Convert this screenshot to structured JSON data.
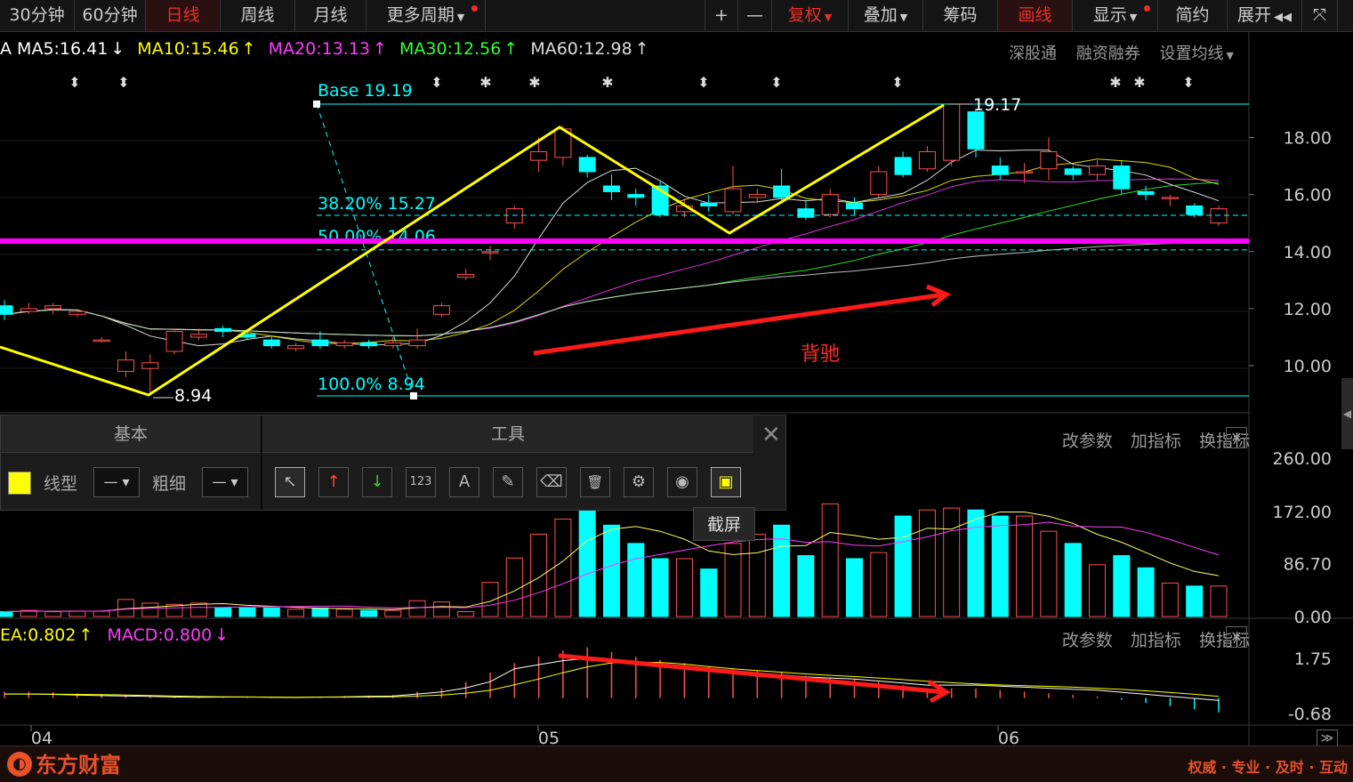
{
  "topbar": {
    "items": [
      {
        "label": "30分钟",
        "active": false
      },
      {
        "label": "60分钟",
        "active": false
      },
      {
        "label": "日线",
        "active": true
      },
      {
        "label": "周线",
        "active": false
      },
      {
        "label": "月线",
        "active": false
      },
      {
        "label": "更多周期",
        "active": false
      },
      {
        "label": "+",
        "active": false
      },
      {
        "label": "—",
        "active": false
      },
      {
        "label": "复权",
        "active": true
      },
      {
        "label": "叠加",
        "active": false
      },
      {
        "label": "筹码",
        "active": false
      },
      {
        "label": "画线",
        "active": true
      },
      {
        "label": "显示",
        "active": false
      },
      {
        "label": "简约",
        "active": false
      },
      {
        "label": "展开",
        "active": false
      }
    ]
  },
  "ma_header": {
    "ma5": "MA5:16.41",
    "ma10": "MA10:15.46",
    "ma20": "MA20:13.13",
    "ma30": "MA30:12.56",
    "ma60": "MA60:12.98",
    "ma5_arrow": "↓",
    "ma10_arrow": "↑",
    "ma20_arrow": "↑",
    "ma30_arrow": "↑",
    "ma60_arrow": "↑",
    "colors": {
      "ma5": "#ffffff",
      "ma10": "#ffff00",
      "ma20": "#ff3cff",
      "ma30": "#33ff33",
      "ma60": "#dddddd"
    }
  },
  "header_links": [
    "深股通",
    "融资融券",
    "设置均线"
  ],
  "price_axis": [
    "18.00",
    "16.00",
    "14.00",
    "12.00",
    "10.00"
  ],
  "volume_axis": [
    "260.00",
    "172.00",
    "86.70",
    "0.00"
  ],
  "macd_axis": [
    "1.75",
    "-0.68"
  ],
  "date_axis": [
    "04",
    "05",
    "06"
  ],
  "annotations": {
    "fib_base": "Base    19.19",
    "fib_382": "38.20% 15.27",
    "fib_500": "50.00% 14.06",
    "fib_100": "100.0% 8.94",
    "peak_label": "19.17",
    "low_label": "8.94",
    "divergence": "背驰"
  },
  "panel": {
    "tab_basic": "基本",
    "tab_tools": "工具",
    "line_type_label": "线型",
    "thickness_label": "粗细",
    "tooltip": "截屏",
    "tool_icons": [
      "pointer-icon",
      "up-arrow-icon",
      "down-arrow-icon",
      "number-icon",
      "text-icon",
      "ruler-icon",
      "eraser-icon",
      "trash-icon",
      "settings-icon",
      "eye-icon",
      "screenshot-icon"
    ],
    "tool_glyphs": [
      "↖",
      "↑",
      "↓",
      "123",
      "A",
      "✎",
      "⌫",
      "🗑",
      "⚙",
      "◉",
      "▣"
    ]
  },
  "sub_options": [
    "改参数",
    "加指标",
    "换指标"
  ],
  "macd_header": {
    "dea": "EA:0.802",
    "dea_arrow": "↑",
    "macd": "MACD:0.800",
    "macd_arrow": "↓"
  },
  "bottombar": {
    "logo": "东方财富",
    "slogan": "权威 · 专业 · 及时 · 互动"
  },
  "colors": {
    "up": "#ff5050",
    "down": "#00ffff",
    "fib": "#00ffff",
    "zigzag": "#ffff00",
    "magenta_line": "#ff00ff",
    "arrow": "#ff1a1a"
  },
  "chart_data": {
    "type": "candlestick",
    "price_ylim": [
      8.0,
      19.5
    ],
    "candles": [
      {
        "o": 12.1,
        "c": 11.8,
        "h": 12.3,
        "l": 11.6
      },
      {
        "o": 11.9,
        "c": 12.0,
        "h": 12.2,
        "l": 11.8
      },
      {
        "o": 12.0,
        "c": 12.1,
        "h": 12.2,
        "l": 11.8
      },
      {
        "o": 11.8,
        "c": 11.9,
        "h": 12.0,
        "l": 11.7
      },
      {
        "o": 10.9,
        "c": 10.9,
        "h": 11.0,
        "l": 10.8
      },
      {
        "o": 9.8,
        "c": 10.2,
        "h": 10.5,
        "l": 9.6
      },
      {
        "o": 9.9,
        "c": 10.1,
        "h": 10.4,
        "l": 8.94
      },
      {
        "o": 10.5,
        "c": 11.2,
        "h": 11.3,
        "l": 10.4
      },
      {
        "o": 11.0,
        "c": 11.1,
        "h": 11.3,
        "l": 10.9
      },
      {
        "o": 11.3,
        "c": 11.2,
        "h": 11.4,
        "l": 11.0
      },
      {
        "o": 11.1,
        "c": 11.0,
        "h": 11.2,
        "l": 10.9
      },
      {
        "o": 10.9,
        "c": 10.7,
        "h": 11.0,
        "l": 10.6
      },
      {
        "o": 10.6,
        "c": 10.7,
        "h": 10.8,
        "l": 10.5
      },
      {
        "o": 10.9,
        "c": 10.7,
        "h": 11.2,
        "l": 10.6
      },
      {
        "o": 10.7,
        "c": 10.8,
        "h": 10.9,
        "l": 10.6
      },
      {
        "o": 10.8,
        "c": 10.7,
        "h": 10.9,
        "l": 10.6
      },
      {
        "o": 10.7,
        "c": 10.8,
        "h": 11.0,
        "l": 10.6
      },
      {
        "o": 10.7,
        "c": 10.9,
        "h": 11.3,
        "l": 10.6
      },
      {
        "o": 11.8,
        "c": 12.1,
        "h": 12.2,
        "l": 11.7
      },
      {
        "o": 13.1,
        "c": 13.2,
        "h": 13.4,
        "l": 13.0
      },
      {
        "o": 14.0,
        "c": 14.0,
        "h": 14.2,
        "l": 13.7
      },
      {
        "o": 15.0,
        "c": 15.5,
        "h": 15.6,
        "l": 14.8
      },
      {
        "o": 17.2,
        "c": 17.5,
        "h": 18.0,
        "l": 16.8
      },
      {
        "o": 17.3,
        "c": 18.3,
        "h": 18.4,
        "l": 17.0
      },
      {
        "o": 17.3,
        "c": 16.8,
        "h": 17.4,
        "l": 16.6
      },
      {
        "o": 16.3,
        "c": 16.1,
        "h": 16.7,
        "l": 15.8
      },
      {
        "o": 16.0,
        "c": 15.9,
        "h": 16.2,
        "l": 15.6
      },
      {
        "o": 16.3,
        "c": 15.3,
        "h": 16.5,
        "l": 15.2
      },
      {
        "o": 15.4,
        "c": 15.6,
        "h": 15.8,
        "l": 15.2
      },
      {
        "o": 15.7,
        "c": 15.6,
        "h": 16.0,
        "l": 15.4
      },
      {
        "o": 15.4,
        "c": 16.2,
        "h": 17.0,
        "l": 15.3
      },
      {
        "o": 15.9,
        "c": 16.0,
        "h": 16.2,
        "l": 15.7
      },
      {
        "o": 16.3,
        "c": 15.9,
        "h": 16.9,
        "l": 15.7
      },
      {
        "o": 15.5,
        "c": 15.2,
        "h": 15.8,
        "l": 15.1
      },
      {
        "o": 15.3,
        "c": 16.0,
        "h": 16.2,
        "l": 15.2
      },
      {
        "o": 15.7,
        "c": 15.5,
        "h": 15.9,
        "l": 15.3
      },
      {
        "o": 16.0,
        "c": 16.8,
        "h": 17.0,
        "l": 15.9
      },
      {
        "o": 17.3,
        "c": 16.7,
        "h": 17.5,
        "l": 16.6
      },
      {
        "o": 16.9,
        "c": 17.5,
        "h": 17.7,
        "l": 16.8
      },
      {
        "o": 17.2,
        "c": 19.17,
        "h": 19.17,
        "l": 17.0
      },
      {
        "o": 18.9,
        "c": 17.6,
        "h": 19.0,
        "l": 17.3
      },
      {
        "o": 17.0,
        "c": 16.7,
        "h": 17.3,
        "l": 16.5
      },
      {
        "o": 16.8,
        "c": 16.8,
        "h": 17.1,
        "l": 16.4
      },
      {
        "o": 16.9,
        "c": 17.5,
        "h": 18.0,
        "l": 16.5
      },
      {
        "o": 16.9,
        "c": 16.7,
        "h": 17.0,
        "l": 16.5
      },
      {
        "o": 16.7,
        "c": 17.0,
        "h": 17.2,
        "l": 16.5
      },
      {
        "o": 17.0,
        "c": 16.2,
        "h": 17.2,
        "l": 16.0
      },
      {
        "o": 16.1,
        "c": 16.0,
        "h": 16.3,
        "l": 15.8
      },
      {
        "o": 15.9,
        "c": 15.9,
        "h": 16.0,
        "l": 15.6
      },
      {
        "o": 15.6,
        "c": 15.3,
        "h": 15.7,
        "l": 15.2
      },
      {
        "o": 15.0,
        "c": 15.5,
        "h": 15.6,
        "l": 14.9
      }
    ],
    "volume_ylim": [
      0,
      300
    ],
    "volume": [
      8,
      10,
      8,
      9,
      9,
      28,
      22,
      20,
      22,
      14,
      14,
      14,
      12,
      14,
      12,
      10,
      10,
      26,
      24,
      8,
      56,
      96,
      135,
      160,
      175,
      150,
      120,
      95,
      95,
      78,
      120,
      135,
      150,
      100,
      185,
      95,
      105,
      165,
      175,
      178,
      175,
      165,
      165,
      140,
      120,
      85,
      100,
      80,
      55,
      50,
      50
    ],
    "macd_ylim": [
      -0.9,
      2.2
    ],
    "macd_hist": [
      0.2,
      0.2,
      0.18,
      0.15,
      0.12,
      0.1,
      0.08,
      0.05,
      0.04,
      0.05,
      0.05,
      0.04,
      0.03,
      0.05,
      0.06,
      0.08,
      0.1,
      0.2,
      0.3,
      0.5,
      0.8,
      1.1,
      1.3,
      1.5,
      1.6,
      1.45,
      1.3,
      1.2,
      1.1,
      1.0,
      0.9,
      0.85,
      0.8,
      0.7,
      0.65,
      0.6,
      0.5,
      0.4,
      0.3,
      0.3,
      0.3,
      0.25,
      0.2,
      0.15,
      0.1,
      0.05,
      -0.05,
      -0.15,
      -0.25,
      -0.35,
      -0.45
    ]
  }
}
